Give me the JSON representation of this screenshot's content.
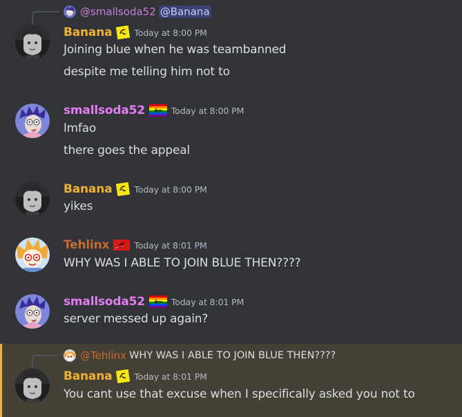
{
  "colors": {
    "background": "#313338",
    "banana_name": "#f0b232",
    "smallsoda_name": "#e37ef0",
    "tehlinx_name": "#c96a2e",
    "highlight_bg": "#444036",
    "highlight_bar": "#e3b443",
    "timestamp": "#b5bac1",
    "text": "#dbdee1"
  },
  "messages": [
    {
      "reply": {
        "author": "@smallsoda52",
        "mention": "@Banana",
        "avatar_icon": "smallsoda-avatar-icon"
      },
      "author": "Banana",
      "role_icon": "banana-role-icon",
      "timestamp": "Today at 8:00 PM",
      "lines": [
        "Joining blue when he was teambanned",
        "despite me telling him not to"
      ]
    },
    {
      "author": "smallsoda52",
      "role_icon": "pride-flag-icon",
      "timestamp": "Today at 8:00 PM",
      "lines": [
        "lmfao",
        "there goes the appeal"
      ]
    },
    {
      "author": "Banana",
      "role_icon": "banana-role-icon",
      "timestamp": "Today at 8:00 PM",
      "lines": [
        "yikes"
      ]
    },
    {
      "author": "Tehlinx",
      "role_icon": "red-role-icon",
      "timestamp": "Today at 8:01 PM",
      "lines": [
        "WHY WAS I ABLE TO JOIN BLUE THEN????"
      ]
    },
    {
      "author": "smallsoda52",
      "role_icon": "pride-flag-icon",
      "timestamp": "Today at 8:01 PM",
      "lines": [
        "server messed up again?"
      ]
    },
    {
      "reply": {
        "author": "@Tehlinx",
        "content": "WHY WAS I ABLE TO JOIN BLUE THEN????",
        "avatar_icon": "tehlinx-avatar-icon"
      },
      "author": "Banana",
      "role_icon": "banana-role-icon",
      "timestamp": "Today at 8:01 PM",
      "lines": [
        "You cant use that excuse when I specifically asked you not to"
      ],
      "highlighted": true
    }
  ]
}
